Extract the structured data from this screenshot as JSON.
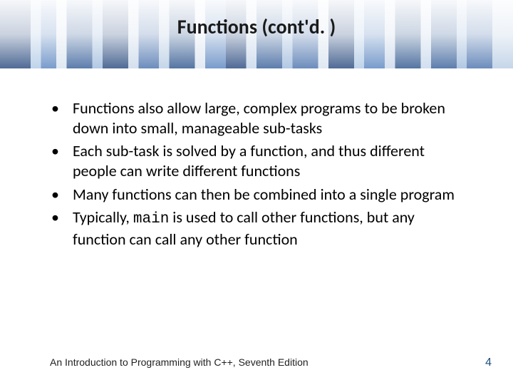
{
  "slide": {
    "title": "Functions (cont'd. )",
    "bullets": [
      {
        "text": "Functions also allow large, complex programs to be broken down into small, manageable sub-tasks"
      },
      {
        "text": "Each sub-task is solved by a function, and thus different people can write different functions"
      },
      {
        "text": "Many functions can then be combined into a single program"
      },
      {
        "pre": "Typically, ",
        "code": "main",
        "post": " is used to call other functions, but any function can call any other function"
      }
    ]
  },
  "footer": {
    "text": "An Introduction to Programming with C++, Seventh Edition",
    "page": "4"
  },
  "bullet_glyph": "•"
}
